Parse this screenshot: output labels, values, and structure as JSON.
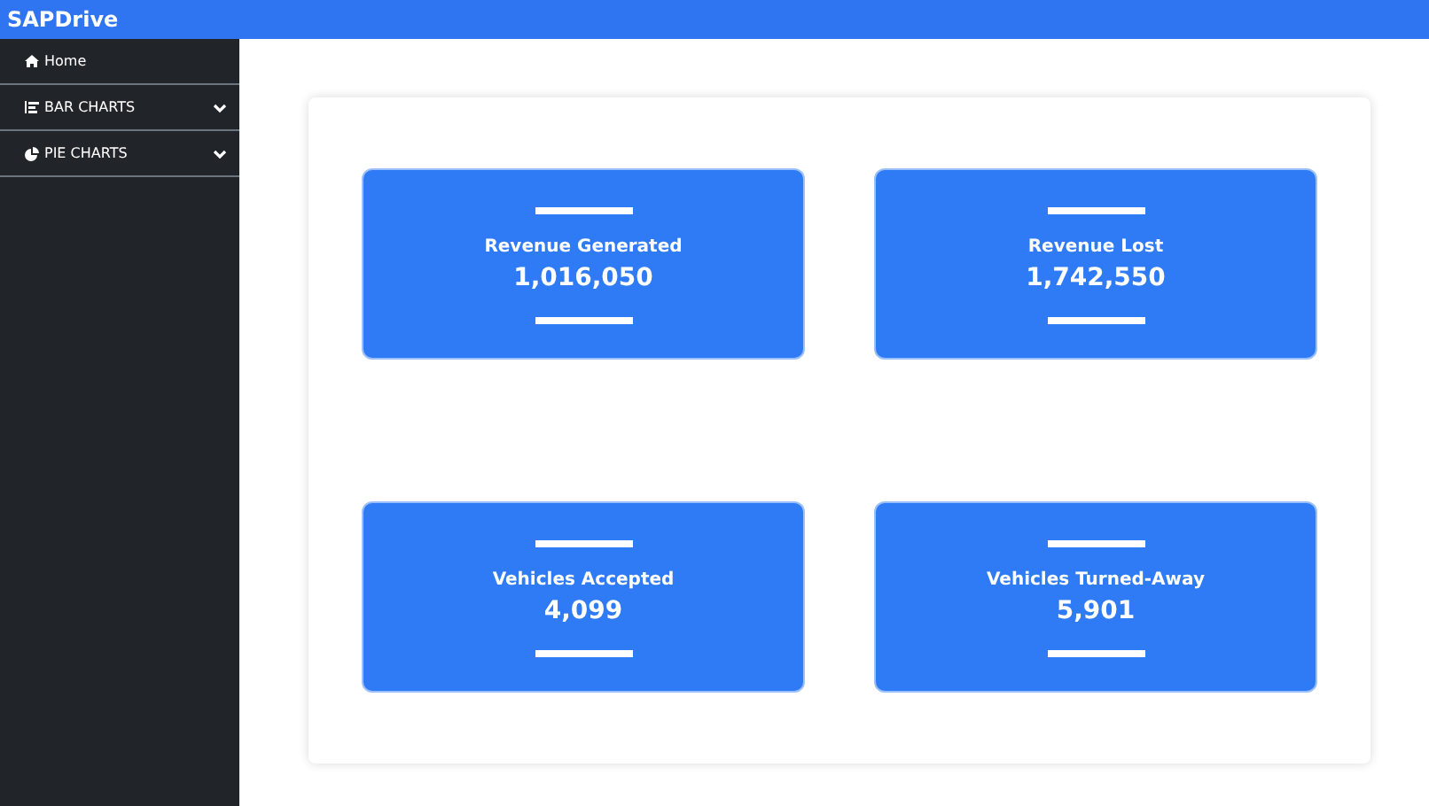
{
  "header": {
    "brand": "SAPDrive"
  },
  "sidebar": {
    "items": [
      {
        "label": "Home",
        "kind": "link"
      },
      {
        "label": "BAR CHARTS",
        "kind": "dropdown",
        "expanded": false
      },
      {
        "label": "PIE CHARTS",
        "kind": "dropdown",
        "expanded": false
      }
    ]
  },
  "stats": [
    {
      "title": "Revenue Generated",
      "value": "1,016,050"
    },
    {
      "title": "Revenue Lost",
      "value": "1,742,550"
    },
    {
      "title": "Vehicles Accepted",
      "value": "4,099"
    },
    {
      "title": "Vehicles Turned-Away",
      "value": "5,901"
    }
  ]
}
